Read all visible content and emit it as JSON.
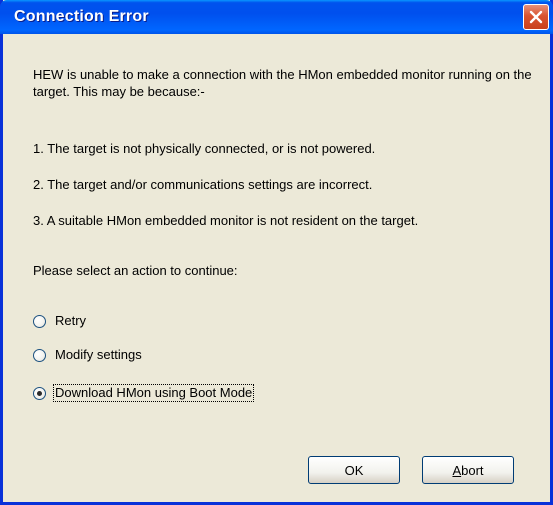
{
  "dialog": {
    "title": "Connection Error",
    "close_icon": "close-icon",
    "intro": "HEW is unable to make a connection with the HMon embedded monitor running on the target. This may be because:-",
    "reasons": [
      "1.  The target is not physically connected, or is not powered.",
      "2.  The target and/or communications settings are incorrect.",
      "3.  A suitable HMon embedded monitor is not resident on the target."
    ],
    "prompt": "Please select an action to continue:",
    "options": [
      {
        "label": "Retry",
        "selected": false
      },
      {
        "label": "Modify settings",
        "selected": false
      },
      {
        "label": "Download HMon using Boot Mode",
        "selected": true
      }
    ],
    "buttons": {
      "ok": "OK",
      "abort_first": "A",
      "abort_rest": "bort"
    }
  },
  "colors": {
    "title_bar": "#0055ea",
    "window_body": "#ece9d8",
    "close_button": "#d9532f",
    "frame": "#0831d9"
  }
}
